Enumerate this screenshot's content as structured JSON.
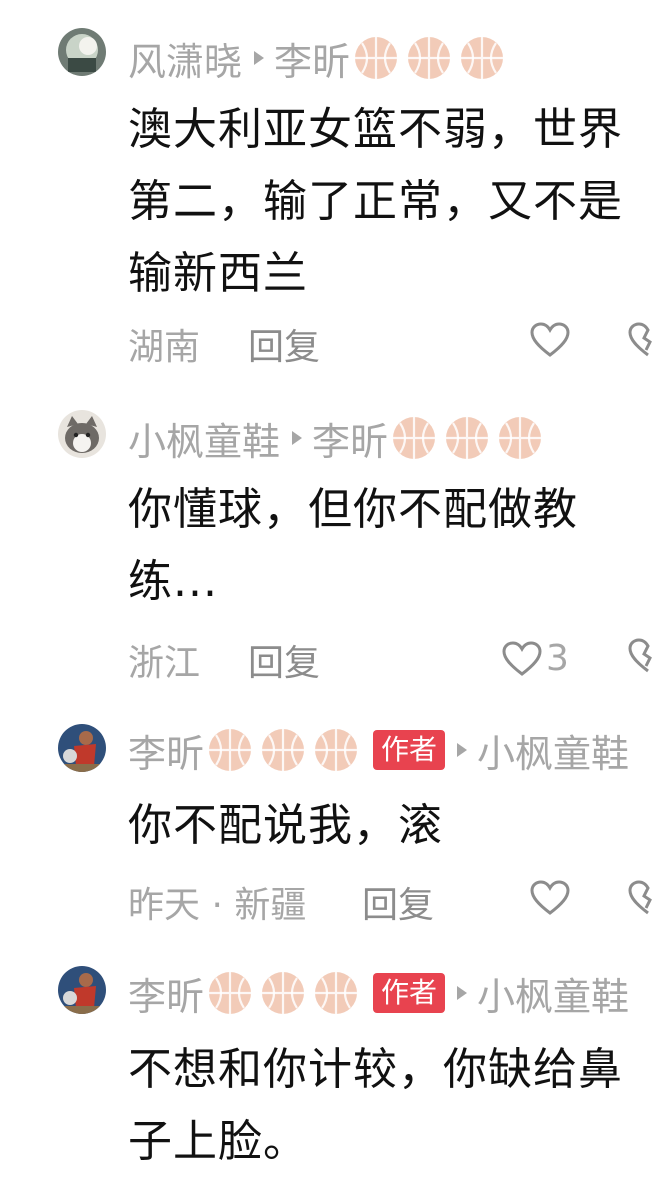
{
  "comments": [
    {
      "username": "风潇晓",
      "reply_to": "李昕",
      "reply_to_badges": [
        "basketball-icon",
        "basketball-icon",
        "basketball-icon"
      ],
      "text_lines": [
        "澳大利亚女篮不弱，世界",
        "第二，输了正常，又不是",
        "输新西兰"
      ],
      "location": "湖南",
      "reply_label": "回复",
      "likes": ""
    },
    {
      "username": "小枫童鞋",
      "reply_to": "李昕",
      "reply_to_badges": [
        "basketball-icon",
        "basketball-icon",
        "basketball-icon"
      ],
      "text_lines": [
        "你懂球，但你不配做教",
        "练..."
      ],
      "location": "浙江",
      "reply_label": "回复",
      "likes": "3"
    },
    {
      "username": "李昕",
      "username_badges": [
        "basketball-icon",
        "basketball-icon",
        "basketball-icon"
      ],
      "author_badge": "作者",
      "reply_to": "小枫童鞋",
      "text_lines": [
        "你不配说我，滚"
      ],
      "location": "昨天 · 新疆",
      "reply_label": "回复",
      "likes": ""
    },
    {
      "username": "李昕",
      "username_badges": [
        "basketball-icon",
        "basketball-icon",
        "basketball-icon"
      ],
      "author_badge": "作者",
      "reply_to": "小枫童鞋",
      "text_lines": [
        "不想和你计较，你缺给鼻",
        "子上脸。"
      ],
      "location": "",
      "reply_label": "",
      "likes": ""
    }
  ],
  "colors": {
    "meta_gray": "#a6a6a6",
    "author_badge_red": "#e8434f",
    "basketball": "#f2cbb8"
  }
}
